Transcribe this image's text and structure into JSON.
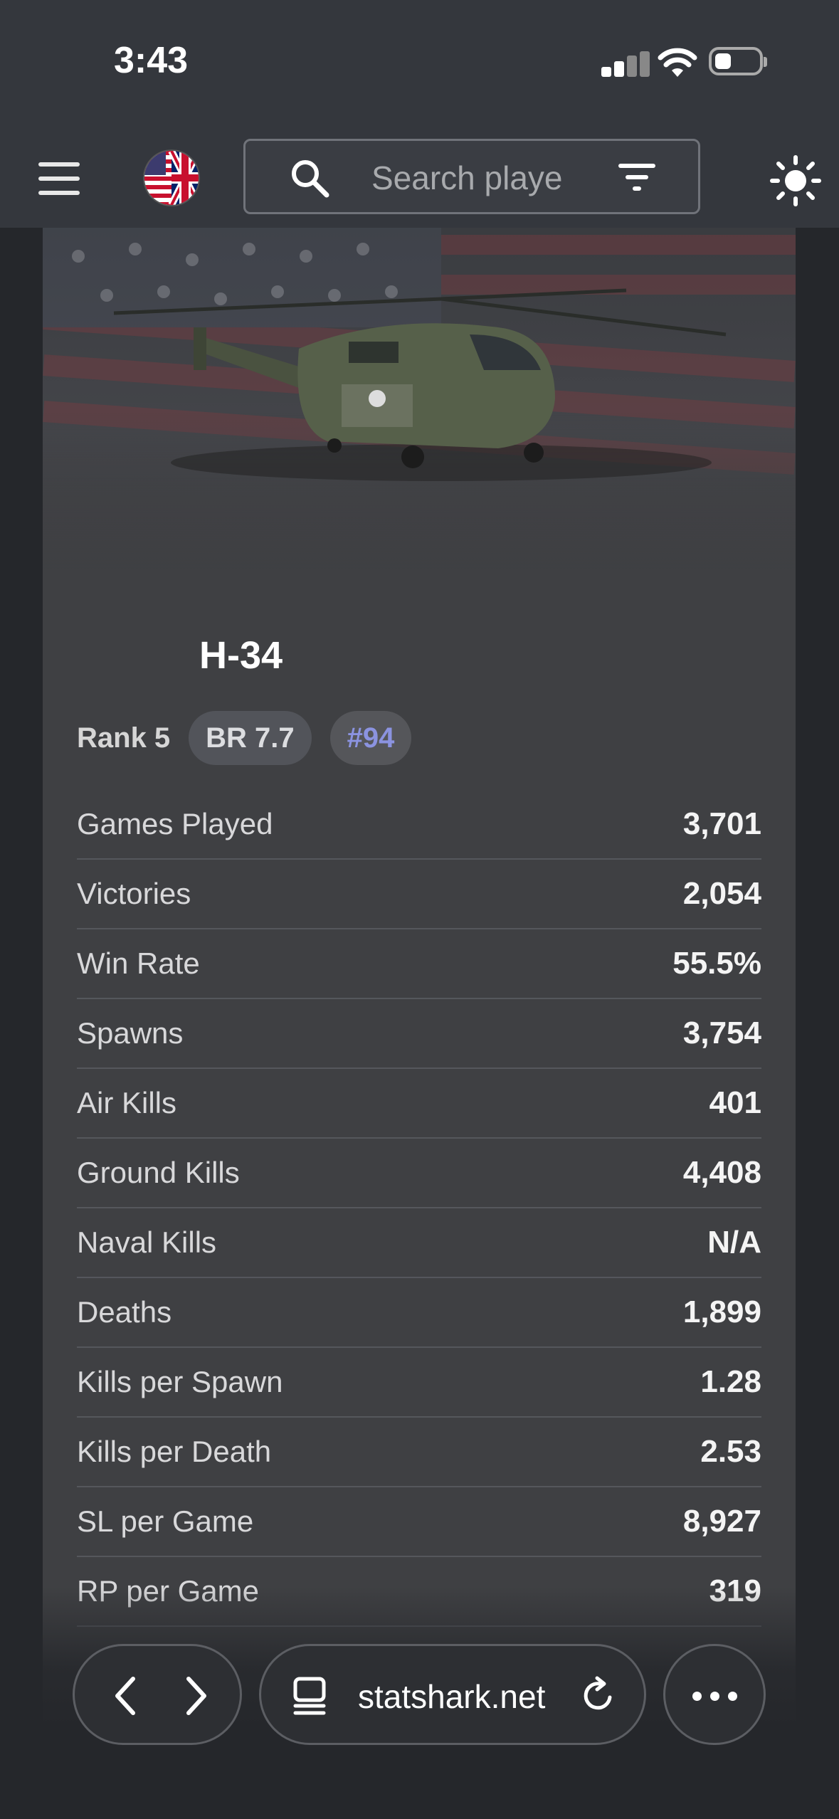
{
  "status_bar": {
    "time": "3:43"
  },
  "nav": {
    "search_placeholder": "Search playe"
  },
  "vehicle": {
    "name": "H-34",
    "rank": "Rank 5",
    "br": "BR 7.7",
    "position": "#94"
  },
  "stats": [
    {
      "label": "Games Played",
      "value": "3,701"
    },
    {
      "label": "Victories",
      "value": "2,054"
    },
    {
      "label": "Win Rate",
      "value": "55.5%"
    },
    {
      "label": "Spawns",
      "value": "3,754"
    },
    {
      "label": "Air Kills",
      "value": "401"
    },
    {
      "label": "Ground Kills",
      "value": "4,408"
    },
    {
      "label": "Naval Kills",
      "value": "N/A"
    },
    {
      "label": "Deaths",
      "value": "1,899"
    },
    {
      "label": "Kills per Spawn",
      "value": "1.28"
    },
    {
      "label": "Kills per Death",
      "value": "2.53"
    },
    {
      "label": "SL per Game",
      "value": "8,927"
    },
    {
      "label": "RP per Game",
      "value": "319"
    }
  ],
  "browser": {
    "url": "statshark.net"
  },
  "colors": {
    "background": "#25272b",
    "card": "#3f4043",
    "accent_position": "#8b93e0"
  }
}
